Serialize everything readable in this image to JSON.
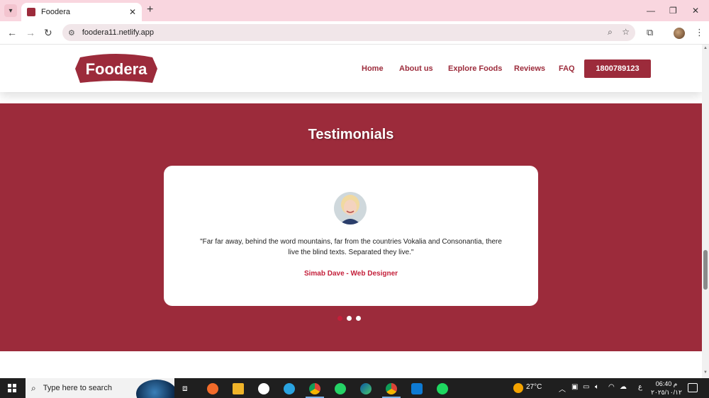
{
  "browser": {
    "tab_title": "Foodera",
    "tab_close": "✕",
    "new_tab": "+",
    "url": "foodera11.netlify.app",
    "win_minimize": "—",
    "win_restore": "❐",
    "win_close": "✕"
  },
  "site": {
    "logo_text": "Foodera",
    "nav": {
      "home": "Home",
      "about": "About us",
      "explore": "Explore Foods",
      "reviews": "Reviews",
      "faq": "FAQ",
      "phone": "1800789123"
    },
    "testimonials": {
      "title": "Testimonials",
      "quote_line1": "\"Far far away, behind the word mountains, far from the countries Vokalia and Consonantia, there",
      "quote_line2": "live the blind texts. Separated they live.\"",
      "author": "Simab Dave - Web Designer",
      "dots": 3,
      "active_dot": 0
    }
  },
  "taskbar": {
    "search_placeholder": "Type here to search",
    "weather": "27°C",
    "lang": "ع",
    "time": "06:40 م",
    "date": "٢٠٢٥/١٠/١٢"
  },
  "colors": {
    "brand": "#9c2b3b",
    "author_red": "#c41f3a"
  },
  "icons": [
    "tab-list-icon",
    "site-settings-icon",
    "zoom-icon",
    "star-icon",
    "extensions-icon",
    "profile-avatar",
    "menu-dots-icon",
    "windows-icon",
    "search-icon",
    "task-view-icon",
    "whatsapp-icon",
    "telegram-icon",
    "chrome-icon",
    "edge-icon",
    "vscode-icon",
    "spotify-icon",
    "notification-icon"
  ]
}
